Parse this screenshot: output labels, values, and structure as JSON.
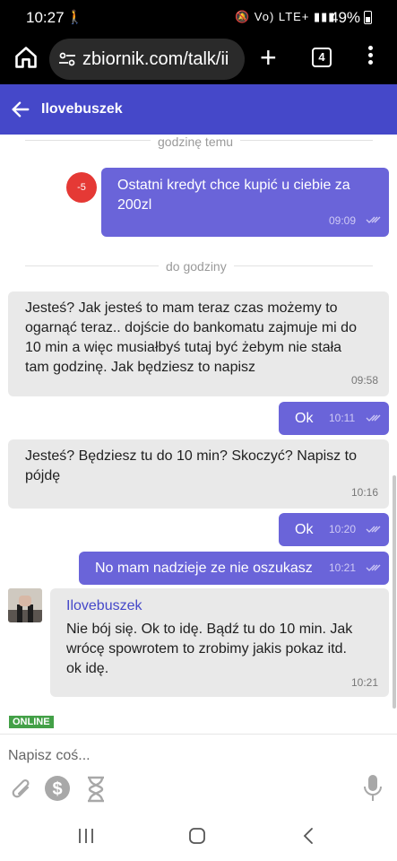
{
  "status_bar": {
    "time": "10:27",
    "battery": "49%",
    "icons": "🔕 Vo) LTE+ ▮▮▮"
  },
  "browser": {
    "url": "zbiornik.com/talk/ii",
    "tab_count": "4"
  },
  "header": {
    "title": "Ilovebuszek"
  },
  "chat": {
    "sep_top": "godzinę temu",
    "sep_mid": "do godziny",
    "messages": [
      {
        "dir": "out",
        "badge": "-5",
        "line1": "Ostatni kredyt chce kupić u ciebie za",
        "line2": "200zl",
        "time": "09:09"
      },
      {
        "dir": "in",
        "lines": [
          "Jesteś? Jak jesteś to mam teraz czas możemy to",
          "ogarnąć teraz.. dojście do bankomatu zajmuje mi do",
          "10 min a więc musiałbyś tutaj być żebym nie stała",
          "tam godzinę. Jak będziesz to napisz"
        ],
        "time": "09:58"
      },
      {
        "dir": "out",
        "text": "Ok",
        "time": "10:11"
      },
      {
        "dir": "in",
        "lines": [
          "Jesteś? Będziesz tu do 10 min? Skoczyć? Napisz to",
          "pójdę"
        ],
        "time": "10:16"
      },
      {
        "dir": "out",
        "text": "Ok",
        "time": "10:20"
      },
      {
        "dir": "out",
        "text": "No mam nadzieje ze nie oszukasz",
        "time": "10:21"
      },
      {
        "dir": "in",
        "sender": "Ilovebuszek",
        "lines": [
          "Nie bój się. Ok to idę. Bądź tu do 10 min. Jak",
          "wrócę spowrotem to zrobimy jakis pokaz itd.",
          "ok idę."
        ],
        "time": "10:21"
      }
    ]
  },
  "online_label": "ONLINE",
  "input": {
    "placeholder": "Napisz coś..."
  },
  "icons": [
    "home-icon",
    "site-settings-icon",
    "plus-icon",
    "tabs-icon",
    "more-icon",
    "back-arrow-icon",
    "double-check-icon",
    "paperclip-icon",
    "dollar-icon",
    "hourglass-icon",
    "microphone-icon",
    "recents-icon",
    "home-nav-icon",
    "back-nav-icon"
  ],
  "colors": {
    "header": "#4548c9",
    "outgoing": "#6a64d9",
    "incoming": "#e9e9e9",
    "badge": "#e53935",
    "online": "#43a047"
  }
}
